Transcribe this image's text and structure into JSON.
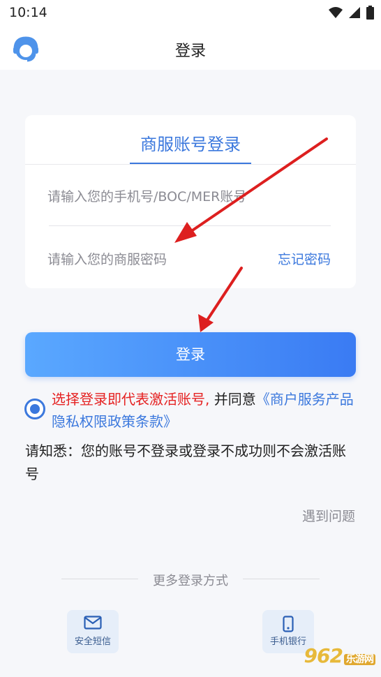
{
  "status_bar": {
    "time": "10:14"
  },
  "header": {
    "title": "登录"
  },
  "card": {
    "tab_label": "商服账号登录",
    "username_placeholder": "请输入您的手机号/BOC/MER账号",
    "password_placeholder": "请输入您的商服密码",
    "forgot_label": "忘记密码"
  },
  "login_button": "登录",
  "agreement": {
    "red_text": "选择登录即代表激活账号,",
    "dark_text": " 并同意",
    "link_text": "《商户服务产品隐私权限政策条款》"
  },
  "notice": "请知悉：您的账号不登录或登录不成功则不会激活账号",
  "problem_link": "遇到问题",
  "more_login": {
    "title": "更多登录方式",
    "methods": [
      {
        "label": "安全短信",
        "icon": "envelope-icon"
      },
      {
        "label": "手机银行",
        "icon": "phone-icon"
      }
    ]
  },
  "watermark": {
    "main": "962",
    "sub": "乐游网"
  },
  "colors": {
    "accent": "#3b78dd",
    "warning": "#e52222",
    "arrow": "#dd1f1f"
  }
}
